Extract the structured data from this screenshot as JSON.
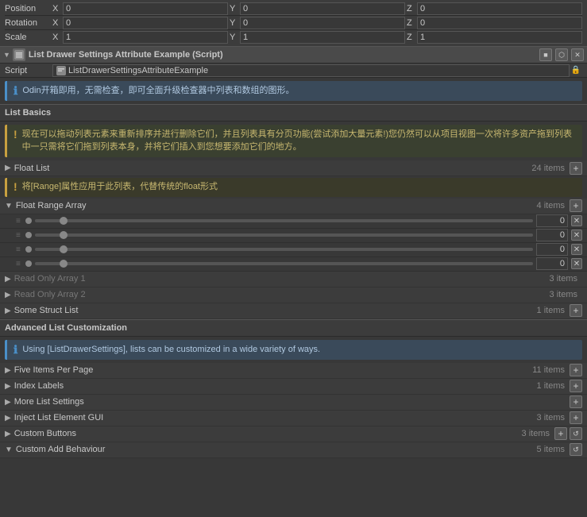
{
  "transform": {
    "rows": [
      {
        "label": "Position",
        "fields": [
          {
            "axis": "X",
            "value": "0"
          },
          {
            "axis": "Y",
            "value": "0"
          },
          {
            "axis": "Z",
            "value": "0"
          }
        ]
      },
      {
        "label": "Rotation",
        "fields": [
          {
            "axis": "X",
            "value": "0"
          },
          {
            "axis": "Y",
            "value": "0"
          },
          {
            "axis": "Z",
            "value": "0"
          }
        ]
      },
      {
        "label": "Scale",
        "fields": [
          {
            "axis": "X",
            "value": "1"
          },
          {
            "axis": "Y",
            "value": "1"
          },
          {
            "axis": "Z",
            "value": "1"
          }
        ]
      }
    ]
  },
  "component": {
    "title": "List Drawer Settings Attribute Example (Script)",
    "script_label": "Script",
    "script_value": "ListDrawerSettingsAttributeExample",
    "header_buttons": [
      "■",
      "⬡",
      "✕"
    ],
    "lock_icon": "🔒"
  },
  "info_message": "Odin开箱即用，无需检查，即可全面升级检查器中列表和数组的图形。",
  "list_basics": {
    "section_title": "List Basics",
    "info_message": "现在可以拖动列表元素来重新排序并进行删除它们，并且列表具有分页功能(尝试添加大量元素!)您仍然可以从项目视图一次将许多资产拖到列表中一只需将它们拖到列表本身，并将它们插入到您想要添加它们的地方。",
    "items": [
      {
        "name": "Float List",
        "count": "24 items",
        "has_add": true,
        "expanded": false,
        "warn": null
      }
    ],
    "warn_message": "将[Range]属性应用于此列表，代替传统的float形式",
    "float_range": {
      "name": "Float Range Array",
      "count": "4 items",
      "has_add": true,
      "expanded": true,
      "sliders": [
        {
          "value": "0"
        },
        {
          "value": "0"
        },
        {
          "value": "0"
        },
        {
          "value": "0"
        }
      ]
    },
    "readonly_1": {
      "name": "Read Only Array 1",
      "count": "3 items",
      "has_add": false
    },
    "readonly_2": {
      "name": "Read Only Array 2",
      "count": "3 items",
      "has_add": false
    },
    "some_struct": {
      "name": "Some Struct List",
      "count": "1 items",
      "has_add": true
    }
  },
  "advanced": {
    "section_title": "Advanced List Customization",
    "info_message": "Using [ListDrawerSettings], lists can be customized in a wide variety of ways.",
    "items": [
      {
        "name": "Five Items Per Page",
        "count": "11 items",
        "has_add": true,
        "has_remove": false
      },
      {
        "name": "Index Labels",
        "count": "1 items",
        "has_add": true,
        "has_remove": false
      },
      {
        "name": "More List Settings",
        "count": null,
        "has_add": true,
        "has_remove": false
      },
      {
        "name": "Inject List Element GUI",
        "count": "3 items",
        "has_add": true,
        "has_remove": false
      },
      {
        "name": "Custom Buttons",
        "count": "3 items",
        "has_add": true,
        "has_remove": true,
        "has_refresh": true
      },
      {
        "name": "Custom Add Behaviour",
        "count": "5 items",
        "has_add": false,
        "has_remove": false,
        "has_refresh": true,
        "expanded": true
      }
    ]
  },
  "icons": {
    "arrow_right": "▶",
    "arrow_down": "▼",
    "add": "+",
    "remove": "✕",
    "drag": "≡",
    "info": "i",
    "warn": "!"
  }
}
